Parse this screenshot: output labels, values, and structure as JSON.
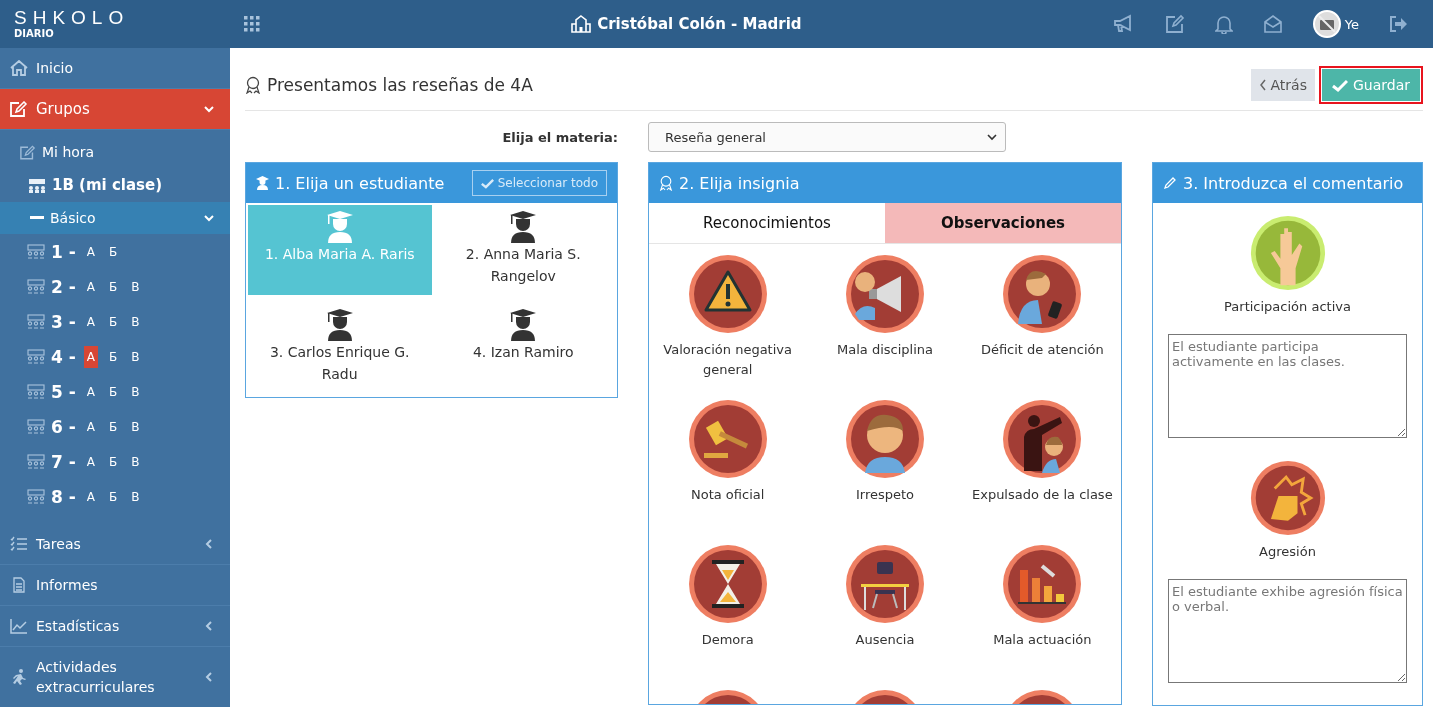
{
  "topbar": {
    "logo": "SHKOLO",
    "logo_sub": "DIARIO",
    "school": "Cristóbal Colón - Madrid",
    "user": "Ye"
  },
  "sidebar": {
    "items": [
      {
        "label": "Inicio",
        "selected": false,
        "expanded": false,
        "caret": false
      },
      {
        "label": "Grupos",
        "selected": true,
        "expanded": true,
        "caret": true,
        "children": [
          {
            "label": "Mi hora",
            "kind": "link"
          },
          {
            "label": "1B (mi clase)",
            "kind": "class"
          },
          {
            "label": "Básico",
            "kind": "section"
          }
        ],
        "grades": [
          {
            "number": "1 -",
            "classes": [
              {
                "label": "А",
                "selected": false
              },
              {
                "label": "Б",
                "selected": false
              }
            ]
          },
          {
            "number": "2 -",
            "classes": [
              {
                "label": "А",
                "selected": false
              },
              {
                "label": "Б",
                "selected": false
              },
              {
                "label": "В",
                "selected": false
              }
            ]
          },
          {
            "number": "3 -",
            "classes": [
              {
                "label": "А",
                "selected": false
              },
              {
                "label": "Б",
                "selected": false
              },
              {
                "label": "В",
                "selected": false
              }
            ]
          },
          {
            "number": "4 -",
            "classes": [
              {
                "label": "А",
                "selected": true
              },
              {
                "label": "Б",
                "selected": false
              },
              {
                "label": "В",
                "selected": false
              }
            ]
          },
          {
            "number": "5 -",
            "classes": [
              {
                "label": "А",
                "selected": false
              },
              {
                "label": "Б",
                "selected": false
              },
              {
                "label": "В",
                "selected": false
              }
            ]
          },
          {
            "number": "6 -",
            "classes": [
              {
                "label": "А",
                "selected": false
              },
              {
                "label": "Б",
                "selected": false
              },
              {
                "label": "В",
                "selected": false
              }
            ]
          },
          {
            "number": "7 -",
            "classes": [
              {
                "label": "А",
                "selected": false
              },
              {
                "label": "Б",
                "selected": false
              },
              {
                "label": "В",
                "selected": false
              }
            ]
          },
          {
            "number": "8 -",
            "classes": [
              {
                "label": "А",
                "selected": false
              },
              {
                "label": "Б",
                "selected": false
              },
              {
                "label": "В",
                "selected": false
              }
            ]
          }
        ]
      },
      {
        "label": "Tareas",
        "selected": false,
        "expanded": false,
        "caret": true
      },
      {
        "label": "Informes",
        "selected": false,
        "expanded": false,
        "caret": false
      },
      {
        "label": "Estadísticas",
        "selected": false,
        "expanded": false,
        "caret": true
      },
      {
        "label": "Actividades extracurriculares",
        "selected": false,
        "expanded": false,
        "caret": true
      }
    ]
  },
  "page": {
    "title": "Presentamos las reseñas de 4A",
    "back": "Atrás",
    "save": "Guardar",
    "subject_label": "Elija el materia:",
    "subject": "Reseña general"
  },
  "students_panel": {
    "title": "1. Elija un estudiante",
    "select_all": "Seleccionar todo",
    "students": [
      {
        "name": "1. Alba Maria A. Raris",
        "selected": true
      },
      {
        "name": "2. Anna Maria S. Rangelov",
        "selected": false
      },
      {
        "name": "3. Carlos Enrique G. Radu",
        "selected": false
      },
      {
        "name": "4. Izan Ramiro",
        "selected": false
      }
    ]
  },
  "badges_panel": {
    "title": "2. Elija insignia",
    "tabs": [
      {
        "label": "Reconocimientos",
        "selected": false
      },
      {
        "label": "Observaciones",
        "selected": true
      }
    ],
    "badges": [
      {
        "label": "Valoración negativa general",
        "kind": "negative"
      },
      {
        "label": "Mala disciplina",
        "kind": "negative"
      },
      {
        "label": "Déficit de atención",
        "kind": "negative"
      },
      {
        "label": "Nota oficial",
        "kind": "negative"
      },
      {
        "label": "Irrespeto",
        "kind": "negative"
      },
      {
        "label": "Expulsado de la clase",
        "kind": "negative"
      },
      {
        "label": "Demora",
        "kind": "negative"
      },
      {
        "label": "Ausencia",
        "kind": "negative"
      },
      {
        "label": "Mala actuación",
        "kind": "negative"
      },
      {
        "kind": "negative"
      },
      {
        "kind": "negative"
      },
      {
        "kind": "negative"
      }
    ]
  },
  "comments_panel": {
    "title": "3. Introduzca el comentario",
    "comments": [
      {
        "badge": "Participación activa",
        "kind": "positive",
        "value": "El estudiante participa activamente en las clases."
      },
      {
        "badge": "Agresión",
        "kind": "negative",
        "value": "El estudiante exhibe agresión física o verbal."
      }
    ]
  }
}
